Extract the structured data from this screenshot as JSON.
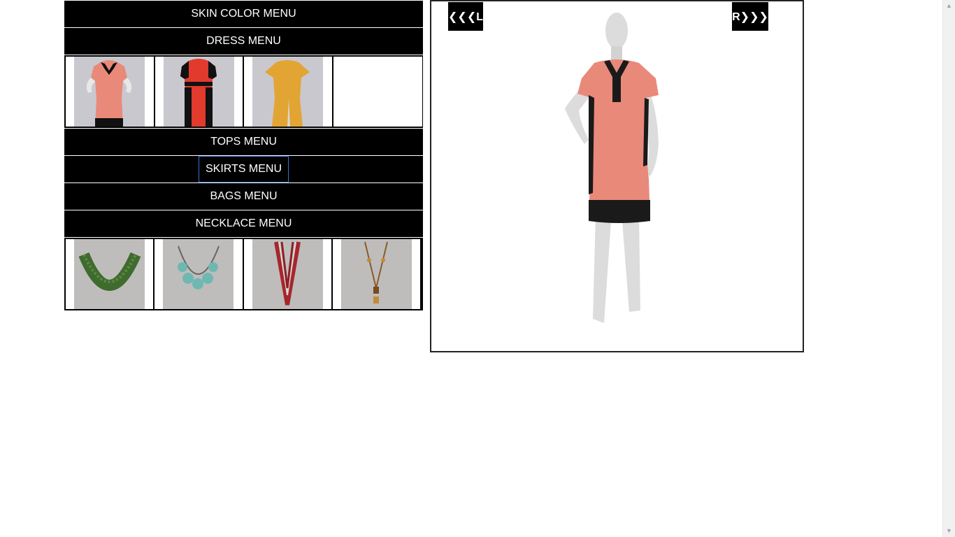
{
  "menus": {
    "skin_color": "SKIN COLOR MENU",
    "dress": "DRESS MENU",
    "tops": "TOPS MENU",
    "skirts": "SKIRTS MENU",
    "bags": "BAGS MENU",
    "necklace": "NECKLACE MENU"
  },
  "dress_thumbnails": [
    {
      "icon": "pink-dress-thumbnail-icon",
      "colors": {
        "body": "#e9897a",
        "trim": "#111111"
      }
    },
    {
      "icon": "red-dress-thumbnail-icon",
      "colors": {
        "body": "#e23a2c",
        "trim": "#111111"
      }
    },
    {
      "icon": "mustard-dress-thumbnail-icon",
      "colors": {
        "body": "#e2a534",
        "trim": "#e2a534"
      }
    }
  ],
  "necklace_thumbnails": [
    {
      "icon": "green-bead-necklace-icon",
      "color": "#3f6b2e"
    },
    {
      "icon": "turquoise-necklace-icon",
      "color": "#6fb8b2"
    },
    {
      "icon": "red-bead-necklace-icon",
      "color": "#a7262c"
    },
    {
      "icon": "amber-pendant-necklace-icon",
      "color": "#8a5a2b"
    }
  ],
  "preview": {
    "left_label": "❮❮❮L",
    "right_label": "R❯❯❯",
    "dress_colors": {
      "body": "#e9897a",
      "trim": "#1a1a1a",
      "mannequin": "#dcdcdc"
    }
  }
}
